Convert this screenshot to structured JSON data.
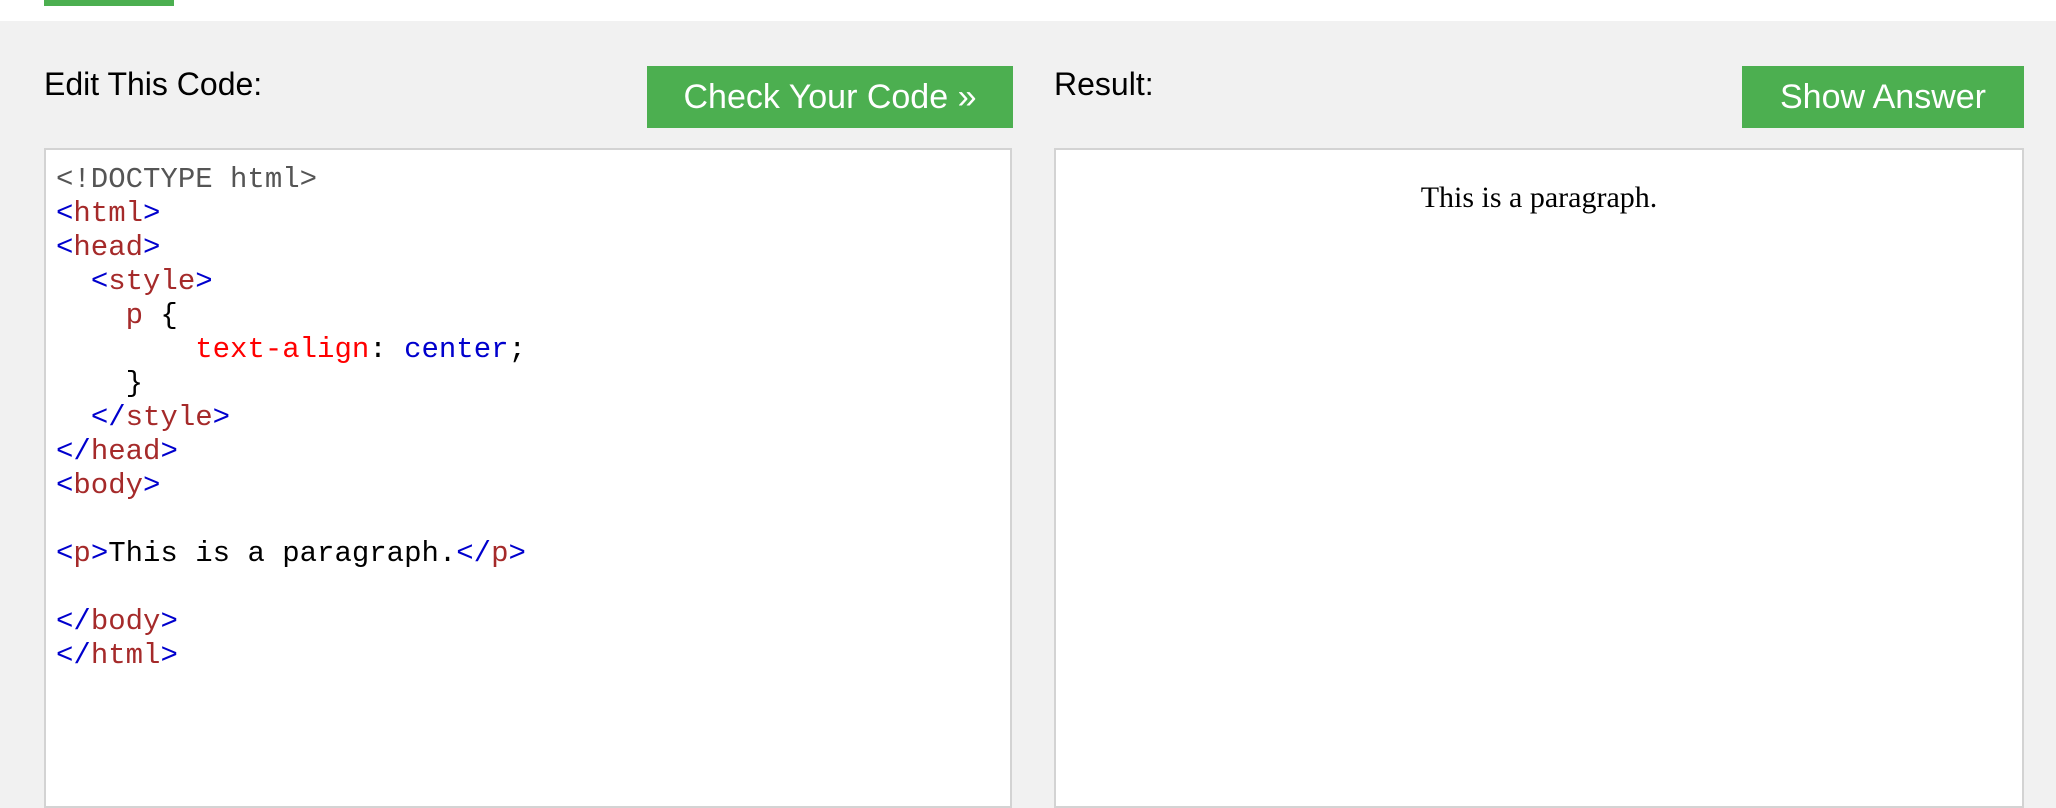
{
  "editor_panel": {
    "label": "Edit This Code:",
    "check_button_label": "Check Your Code »"
  },
  "result_panel": {
    "label": "Result:",
    "show_answer_label": "Show Answer",
    "paragraph_text": "This is a paragraph."
  },
  "code": {
    "line1": {
      "doctype": "<!DOCTYPE html>"
    },
    "line2": {
      "open": "<",
      "tag": "html",
      "close": ">"
    },
    "line3": {
      "open": "<",
      "tag": "head",
      "close": ">"
    },
    "line4": {
      "indent": "  ",
      "open": "<",
      "tag": "style",
      "close": ">"
    },
    "line5": {
      "indent": "    ",
      "selector": "p",
      "brace": " {"
    },
    "line6": {
      "indent": "        ",
      "property": "text-align",
      "colon": ": ",
      "value": "center",
      "semicolon": ";"
    },
    "line7": {
      "indent": "    ",
      "brace": "}"
    },
    "line8": {
      "indent": "  ",
      "open": "</",
      "tag": "style",
      "close": ">"
    },
    "line9": {
      "open": "</",
      "tag": "head",
      "close": ">"
    },
    "line10": {
      "open": "<",
      "tag": "body",
      "close": ">"
    },
    "line12": {
      "open1": "<",
      "tag1": "p",
      "close1": ">",
      "text": "This is a paragraph.",
      "open2": "</",
      "tag2": "p",
      "close2": ">"
    },
    "line14": {
      "open": "</",
      "tag": "body",
      "close": ">"
    },
    "line15": {
      "open": "</",
      "tag": "html",
      "close": ">"
    }
  },
  "colors": {
    "accent": "#4caf50",
    "background": "#f1f1f1",
    "tag_bracket": "#0000cd",
    "tag_name": "#a52a2a",
    "css_property": "#ff0000",
    "css_value": "#0000cd"
  }
}
